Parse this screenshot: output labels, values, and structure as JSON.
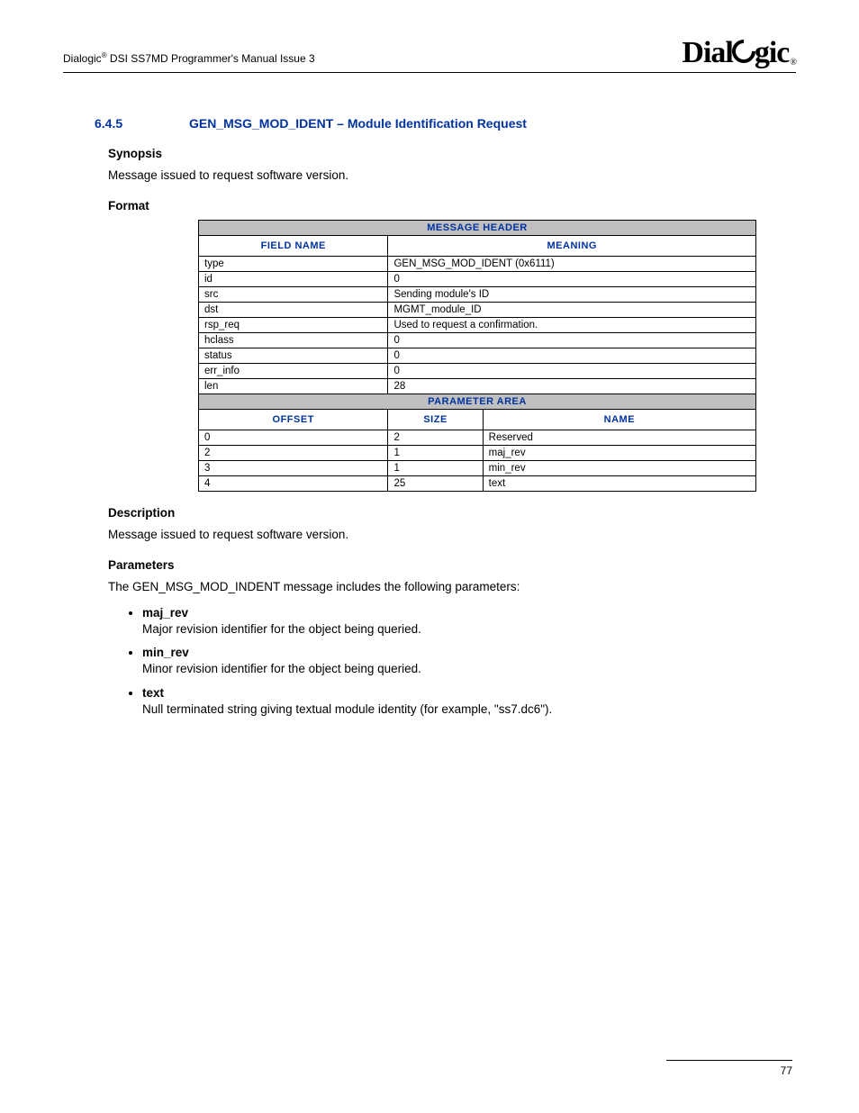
{
  "header": {
    "brand": "Dialogic",
    "sup": "®",
    "doc_title": " DSI SS7MD Programmer's Manual  Issue 3",
    "logo_prefix": "Dial",
    "logo_suffix": "gic",
    "logo_reg": "®"
  },
  "section": {
    "number": "6.4.5",
    "title": "GEN_MSG_MOD_IDENT – Module Identification Request"
  },
  "synopsis": {
    "heading": "Synopsis",
    "text": "Message issued to request software version."
  },
  "format": {
    "heading": "Format",
    "message_header_label": "MESSAGE HEADER",
    "field_name_label": "FIELD NAME",
    "meaning_label": "MEANING",
    "rows": [
      {
        "field": "type",
        "meaning": "GEN_MSG_MOD_IDENT (0x6111)"
      },
      {
        "field": "id",
        "meaning": "0"
      },
      {
        "field": "src",
        "meaning": "Sending module's ID"
      },
      {
        "field": "dst",
        "meaning": "MGMT_module_ID"
      },
      {
        "field": "rsp_req",
        "meaning": "Used to request a confirmation."
      },
      {
        "field": "hclass",
        "meaning": "0"
      },
      {
        "field": "status",
        "meaning": "0"
      },
      {
        "field": "err_info",
        "meaning": "0"
      },
      {
        "field": "len",
        "meaning": "28"
      }
    ],
    "parameter_area_label": "PARAMETER AREA",
    "offset_label": "OFFSET",
    "size_label": "SIZE",
    "name_label": "NAME",
    "param_rows": [
      {
        "offset": "0",
        "size": "2",
        "name": "Reserved"
      },
      {
        "offset": "2",
        "size": "1",
        "name": "maj_rev"
      },
      {
        "offset": "3",
        "size": "1",
        "name": "min_rev"
      },
      {
        "offset": "4",
        "size": "25",
        "name": "text"
      }
    ]
  },
  "description": {
    "heading": "Description",
    "text": "Message issued to request software version."
  },
  "parameters": {
    "heading": "Parameters",
    "intro": "The GEN_MSG_MOD_INDENT message includes the following parameters:",
    "list": [
      {
        "name": "maj_rev",
        "desc": "Major revision identifier for the object being queried."
      },
      {
        "name": "min_rev",
        "desc": "Minor revision identifier for the object being queried."
      },
      {
        "name": "text",
        "desc": "Null terminated string giving textual module identity (for example, \"ss7.dc6\")."
      }
    ]
  },
  "footer": {
    "page": "77"
  }
}
